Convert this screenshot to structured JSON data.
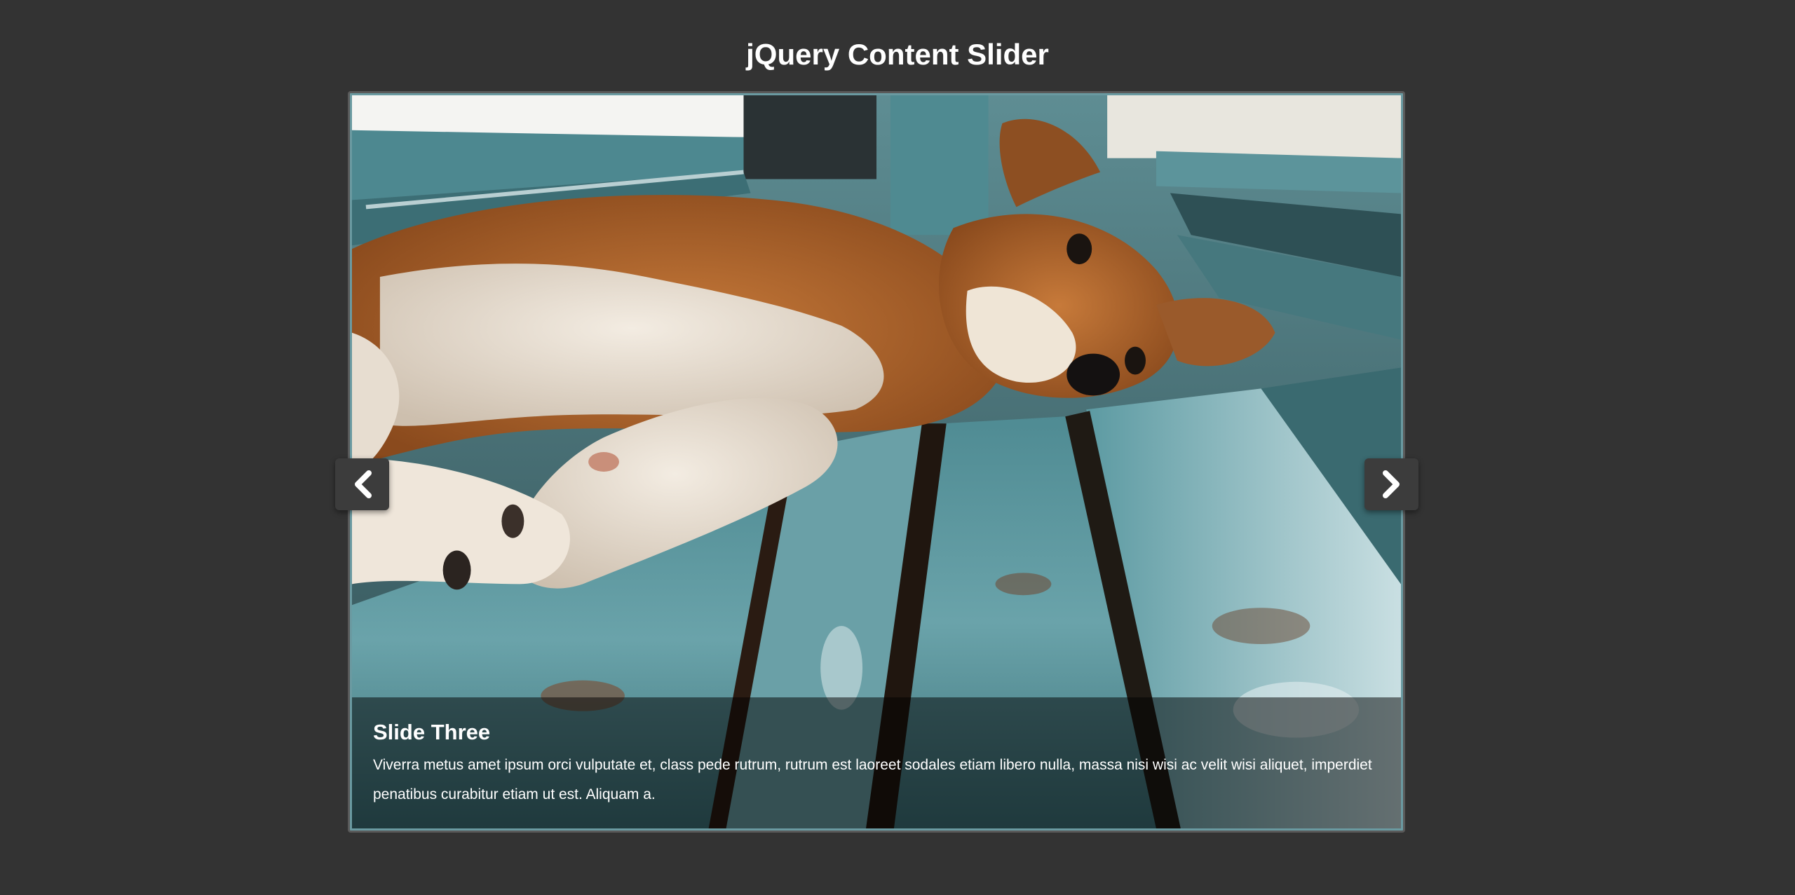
{
  "page": {
    "title": "jQuery Content Slider"
  },
  "slider": {
    "image_alt": "Dog lying on a weathered teal wooden bench",
    "caption": {
      "title": "Slide Three",
      "text": "Viverra metus amet ipsum orci vulputate et, class pede rutrum, rutrum est laoreet sodales etiam libero nulla, massa nisi wisi ac velit wisi aliquet, imperdiet penatibus curabitur etiam ut est. Aliquam a."
    },
    "prev_icon": "chevron-left-icon",
    "next_icon": "chevron-right-icon"
  },
  "colors": {
    "background": "#333333",
    "nav_button": "#3c3c3c",
    "slider_border": "#5a5a5a",
    "bench_teal": "#5f9aa3",
    "dog_fur": "#a8602a"
  }
}
